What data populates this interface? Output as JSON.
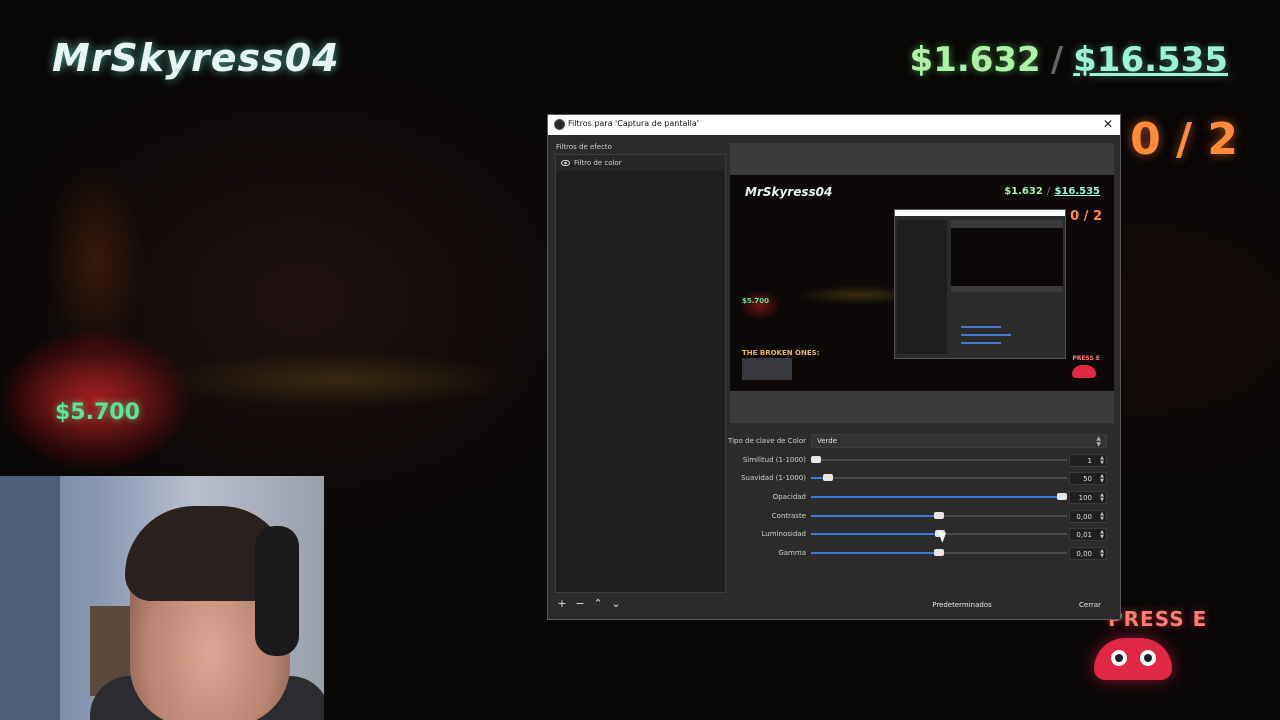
{
  "game": {
    "player_name": "MrSkyress04",
    "money_current": "$1.632",
    "money_separator": "/",
    "money_goal": "$16.535",
    "counter": "0 / 2",
    "pickup_value": "$5.700",
    "press_prompt": "PRESS E"
  },
  "dialog": {
    "title": "Filtros para 'Captura de pantalla'",
    "close_glyph": "✕",
    "effects_section_label": "Filtros de efecto",
    "filters": [
      {
        "label": "Filtro de color",
        "visible": true
      }
    ],
    "list_toolbar": {
      "add": "+",
      "remove": "−",
      "up": "⌃",
      "down": "⌄"
    },
    "preview": {
      "player_name": "MrSkyress04",
      "money_current": "$1.632",
      "money_separator": "/",
      "money_goal": "$16.535",
      "counter": "0 / 2",
      "pickup_value": "$5.700",
      "broken_ones": "THE BROKEN ONES:",
      "press_prompt": "PRESS E"
    },
    "properties": {
      "key_type_label": "Tipo de clave de Color",
      "key_type_value": "Verde",
      "sliders": [
        {
          "label": "Similitud (1-1000)",
          "value": "1",
          "fraction": 0.0
        },
        {
          "label": "Suavidad (1-1000)",
          "value": "50",
          "fraction": 0.05
        },
        {
          "label": "Opacidad",
          "value": "100",
          "fraction": 1.0
        },
        {
          "label": "Contraste",
          "value": "0,00",
          "fraction": 0.5
        },
        {
          "label": "Luminosidad",
          "value": "0,01",
          "fraction": 0.505
        },
        {
          "label": "Gamma",
          "value": "0,00",
          "fraction": 0.5
        }
      ]
    },
    "buttons": {
      "defaults": "Predeterminados",
      "close": "Cerrar"
    }
  },
  "colors": {
    "accent": "#3b78d8",
    "dialog_bg": "#2b2b2b",
    "money_green": "#aef0a8",
    "counter_orange": "#ff8a3a"
  }
}
